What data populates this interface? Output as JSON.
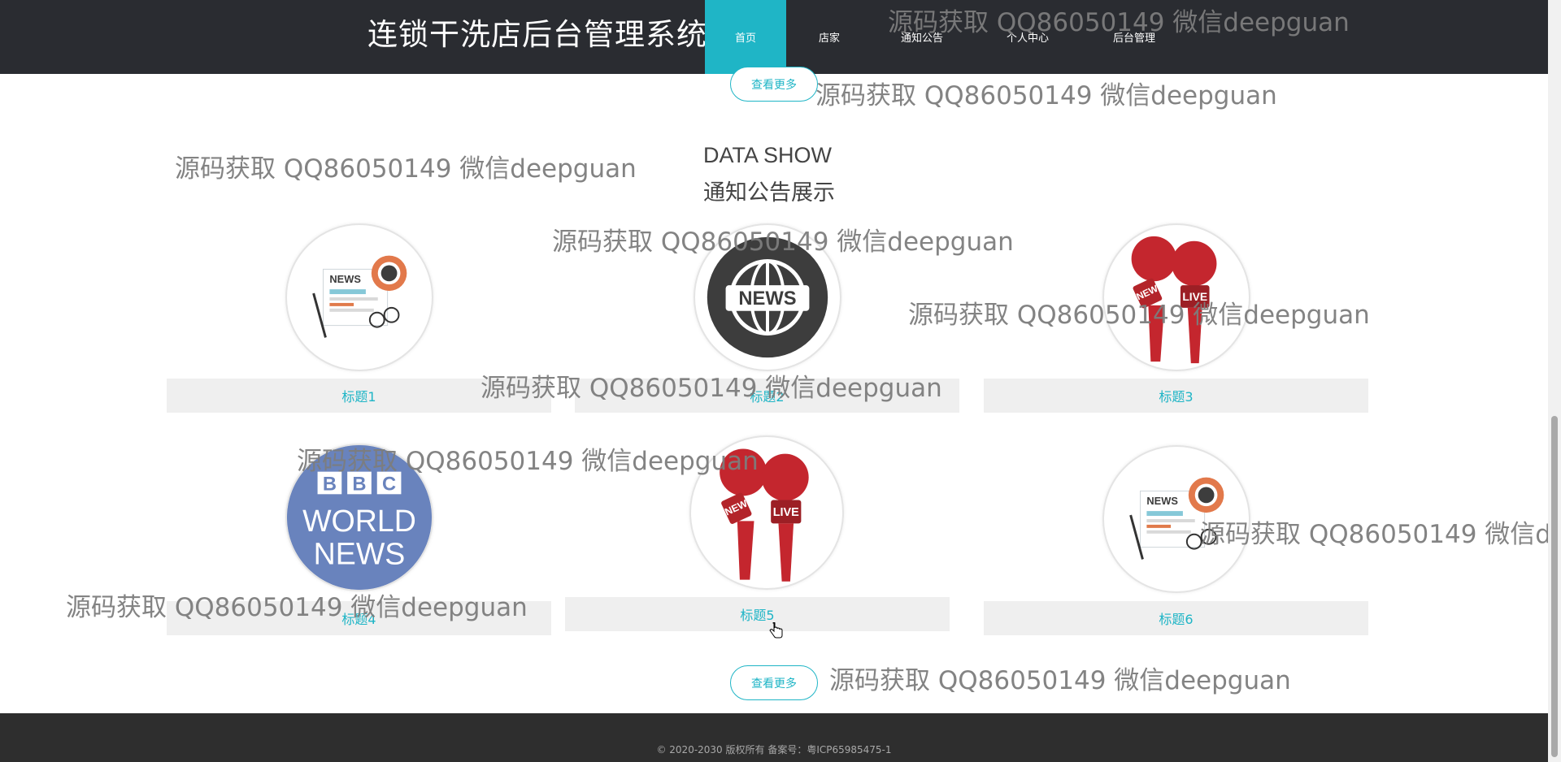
{
  "header": {
    "title": "连锁干洗店后台管理系统",
    "nav": [
      "首页",
      "店家",
      "通知公告",
      "个人中心",
      "后台管理"
    ]
  },
  "top_more": "查看更多",
  "section": {
    "en": "DATA SHOW",
    "cn": "通知公告展示"
  },
  "cards": [
    {
      "title": "标题1",
      "image": "newspaper-icon"
    },
    {
      "title": "标题2",
      "image": "globe-news-icon"
    },
    {
      "title": "标题3",
      "image": "live-microphone-icon"
    },
    {
      "title": "标题4",
      "image": "bbc-world-news-logo"
    },
    {
      "title": "标题5",
      "image": "live-microphone-icon"
    },
    {
      "title": "标题6",
      "image": "newspaper-icon"
    }
  ],
  "bottom_more": "查看更多",
  "watermark": "源码获取 QQ86050149 微信deepguan",
  "logos": {
    "globe": "NEWS",
    "bbc": [
      "B",
      "B",
      "C",
      "WORLD",
      "NEWS"
    ],
    "mic_flag": "NEWS",
    "mic_badge": "LIVE",
    "paper": "NEWS"
  },
  "footer": "© 2020-2030 版权所有 备案号：粤ICP65985475-1",
  "colors": {
    "accent": "#1fb5c6",
    "header_bg": "#2a2c31",
    "footer_bg": "#2e2e2e",
    "card_label_bg": "#efefef"
  }
}
